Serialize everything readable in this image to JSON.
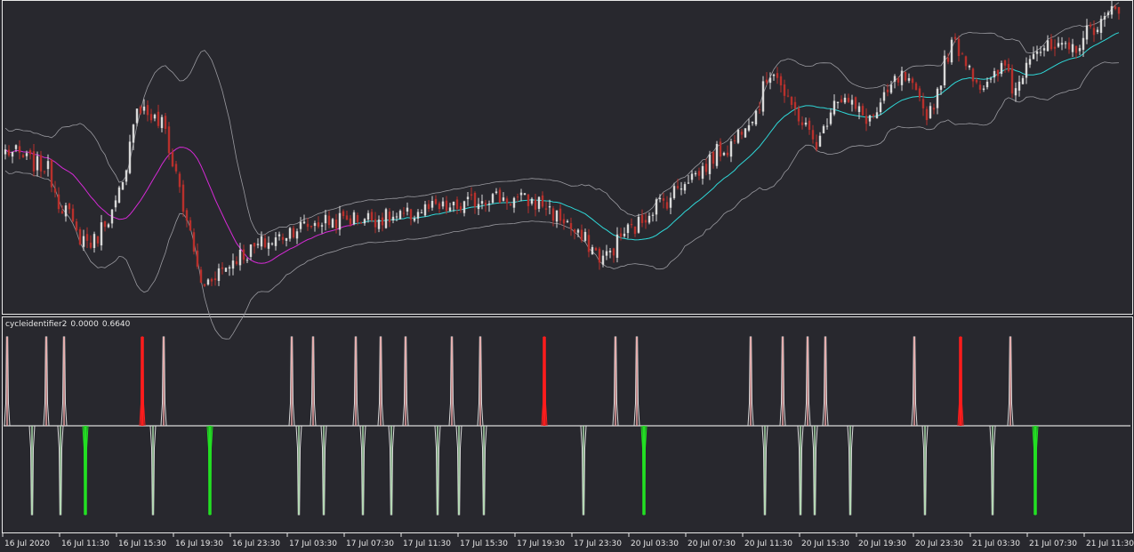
{
  "indicator": {
    "name": "cycleidentifier2",
    "value1": "0.0000",
    "value2": "0.6640"
  },
  "colors": {
    "background": "#28282e",
    "frame": "#e8e8e8",
    "bull_candle": "#d9d9d9",
    "bear_candle": "#b8302c",
    "ma_below": "#d62ad6",
    "ma_above": "#2fd8d8",
    "bands": "#9a9aa0",
    "cycle_line": "#dcdcdc",
    "major_high": "#ff1c1c",
    "minor_high": "#e8a0a0",
    "major_low": "#22e022",
    "minor_low": "#a8d8a8"
  },
  "chart_data": [
    {
      "type": "candlestick",
      "title": "",
      "overlays": [
        "moving-average",
        "bollinger-bands"
      ],
      "x_tick_labels": [
        "16 Jul 2020",
        "16 Jul 11:30",
        "16 Jul 15:30",
        "16 Jul 19:30",
        "16 Jul 23:30",
        "17 Jul 03:30",
        "17 Jul 07:30",
        "17 Jul 11:30",
        "17 Jul 15:30",
        "17 Jul 19:30",
        "17 Jul 23:30",
        "20 Jul 03:30",
        "20 Jul 07:30",
        "20 Jul 11:30",
        "20 Jul 15:30",
        "20 Jul 19:30",
        "20 Jul 23:30",
        "21 Jul 03:30",
        "21 Jul 07:30",
        "21 Jul 11:30"
      ],
      "bars_per_tick": 16,
      "candle_count": 314,
      "y_range": [
        0,
        100
      ],
      "grid": false,
      "close_series_keypoints": [
        [
          0,
          52
        ],
        [
          15,
          47
        ],
        [
          22,
          34
        ],
        [
          28,
          24
        ],
        [
          33,
          22
        ],
        [
          40,
          31
        ],
        [
          45,
          40
        ],
        [
          50,
          67
        ],
        [
          60,
          61
        ],
        [
          65,
          45
        ],
        [
          70,
          26
        ],
        [
          75,
          8
        ],
        [
          82,
          13
        ],
        [
          90,
          18
        ],
        [
          100,
          22
        ],
        [
          112,
          27
        ],
        [
          122,
          29
        ],
        [
          135,
          30
        ],
        [
          150,
          30
        ],
        [
          162,
          33
        ],
        [
          170,
          33
        ],
        [
          185,
          37
        ],
        [
          195,
          36
        ],
        [
          204,
          35
        ],
        [
          212,
          30
        ],
        [
          220,
          23
        ],
        [
          228,
          17
        ],
        [
          238,
          26
        ],
        [
          250,
          35
        ],
        [
          262,
          44
        ],
        [
          275,
          53
        ],
        [
          285,
          64
        ],
        [
          293,
          79
        ],
        [
          300,
          66
        ],
        [
          310,
          55
        ],
        [
          317,
          70
        ],
        [
          330,
          63
        ],
        [
          342,
          76
        ],
        [
          352,
          65
        ],
        [
          362,
          87
        ],
        [
          374,
          73
        ],
        [
          382,
          80
        ],
        [
          385,
          72
        ],
        [
          392,
          86
        ],
        [
          405,
          85
        ],
        [
          418,
          94
        ],
        [
          425,
          100
        ]
      ],
      "ma_cross_index": 133
    },
    {
      "type": "cycle-indicator",
      "name": "cycleidentifier2",
      "values_shown": [
        "0.0000",
        "0.6640"
      ],
      "y_range": [
        -1,
        1
      ],
      "baseline": 0,
      "peaks": [
        {
          "bar": 1,
          "type": "minor"
        },
        {
          "bar": 12,
          "type": "minor"
        },
        {
          "bar": 17,
          "type": "minor"
        },
        {
          "bar": 39,
          "type": "major"
        },
        {
          "bar": 45,
          "type": "minor"
        },
        {
          "bar": 81,
          "type": "minor"
        },
        {
          "bar": 87,
          "type": "minor"
        },
        {
          "bar": 99,
          "type": "minor"
        },
        {
          "bar": 106,
          "type": "minor"
        },
        {
          "bar": 113,
          "type": "minor"
        },
        {
          "bar": 126,
          "type": "minor"
        },
        {
          "bar": 134,
          "type": "minor"
        },
        {
          "bar": 152,
          "type": "major"
        },
        {
          "bar": 172,
          "type": "minor"
        },
        {
          "bar": 178,
          "type": "minor"
        },
        {
          "bar": 210,
          "type": "minor"
        },
        {
          "bar": 219,
          "type": "minor"
        },
        {
          "bar": 226,
          "type": "minor"
        },
        {
          "bar": 231,
          "type": "minor"
        },
        {
          "bar": 256,
          "type": "minor"
        },
        {
          "bar": 269,
          "type": "major"
        },
        {
          "bar": 283,
          "type": "minor"
        }
      ],
      "troughs": [
        {
          "bar": 8,
          "type": "minor"
        },
        {
          "bar": 16,
          "type": "minor"
        },
        {
          "bar": 23,
          "type": "major"
        },
        {
          "bar": 42,
          "type": "minor"
        },
        {
          "bar": 58,
          "type": "major"
        },
        {
          "bar": 83,
          "type": "minor"
        },
        {
          "bar": 90,
          "type": "minor"
        },
        {
          "bar": 101,
          "type": "minor"
        },
        {
          "bar": 109,
          "type": "minor"
        },
        {
          "bar": 122,
          "type": "minor"
        },
        {
          "bar": 128,
          "type": "minor"
        },
        {
          "bar": 135,
          "type": "minor"
        },
        {
          "bar": 163,
          "type": "minor"
        },
        {
          "bar": 180,
          "type": "major"
        },
        {
          "bar": 214,
          "type": "minor"
        },
        {
          "bar": 224,
          "type": "minor"
        },
        {
          "bar": 228,
          "type": "minor"
        },
        {
          "bar": 238,
          "type": "minor"
        },
        {
          "bar": 259,
          "type": "minor"
        },
        {
          "bar": 278,
          "type": "minor"
        },
        {
          "bar": 290,
          "type": "major"
        }
      ]
    }
  ]
}
